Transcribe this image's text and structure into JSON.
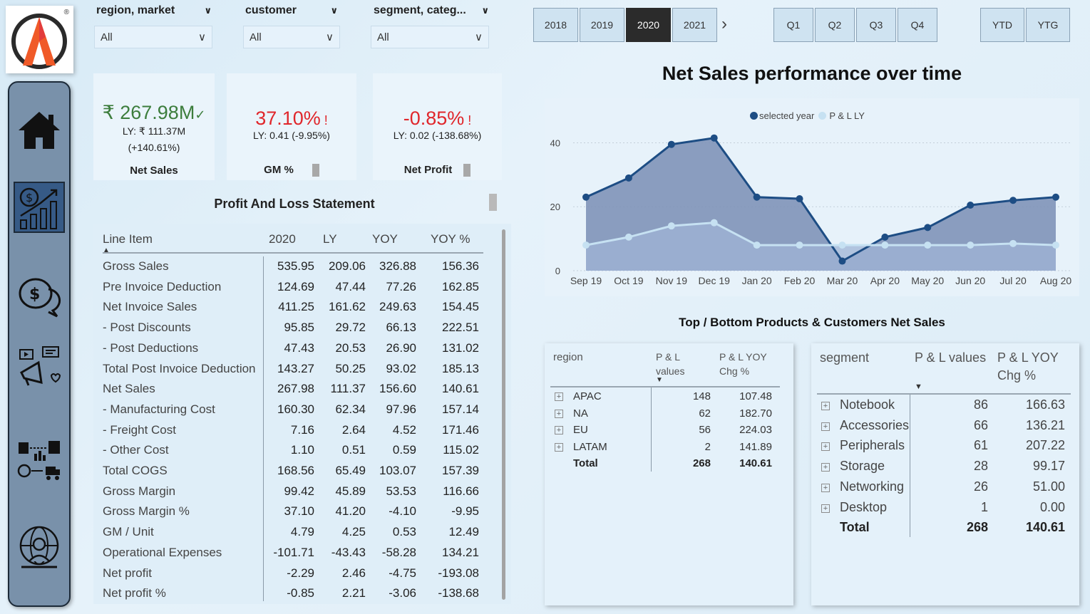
{
  "slicers": [
    {
      "title": "region, market",
      "value": "All"
    },
    {
      "title": "customer",
      "value": "All"
    },
    {
      "title": "segment, categ...",
      "value": "All"
    }
  ],
  "years": [
    "2018",
    "2019",
    "2020",
    "2021"
  ],
  "selected_year": "2020",
  "quarters": [
    "Q1",
    "Q2",
    "Q3",
    "Q4"
  ],
  "periods": [
    "YTD",
    "YTG"
  ],
  "kpis": {
    "net_sales": {
      "value": "₹ 267.98M",
      "ly": "LY: ₹ 111.37M",
      "chg": "(+140.61%)",
      "label": "Net Sales"
    },
    "gm": {
      "value": "37.10%",
      "ly": "LY: 0.41 (-9.95%)",
      "label": "GM %"
    },
    "np": {
      "value": "-0.85%",
      "ly": "LY: 0.02 (-138.68%)",
      "label": "Net Profit"
    }
  },
  "pl": {
    "title": "Profit And Loss Statement",
    "columns": [
      "Line Item",
      "2020",
      "LY",
      "YOY",
      "YOY %"
    ],
    "rows": [
      [
        "Gross Sales",
        "535.95",
        "209.06",
        "326.88",
        "156.36"
      ],
      [
        "Pre Invoice Deduction",
        "124.69",
        "47.44",
        "77.26",
        "162.85"
      ],
      [
        "Net Invoice Sales",
        "411.25",
        "161.62",
        "249.63",
        "154.45"
      ],
      [
        "- Post Discounts",
        "95.85",
        "29.72",
        "66.13",
        "222.51"
      ],
      [
        "- Post Deductions",
        "47.43",
        "20.53",
        "26.90",
        "131.02"
      ],
      [
        "Total Post Invoice Deduction",
        "143.27",
        "50.25",
        "93.02",
        "185.13"
      ],
      [
        "Net Sales",
        "267.98",
        "111.37",
        "156.60",
        "140.61"
      ],
      [
        "- Manufacturing Cost",
        "160.30",
        "62.34",
        "97.96",
        "157.14"
      ],
      [
        "- Freight Cost",
        "7.16",
        "2.64",
        "4.52",
        "171.46"
      ],
      [
        "- Other Cost",
        "1.10",
        "0.51",
        "0.59",
        "115.02"
      ],
      [
        "Total COGS",
        "168.56",
        "65.49",
        "103.07",
        "157.39"
      ],
      [
        "Gross Margin",
        "99.42",
        "45.89",
        "53.53",
        "116.66"
      ],
      [
        "Gross Margin %",
        "37.10",
        "41.20",
        "-4.10",
        "-9.95"
      ],
      [
        "GM / Unit",
        "4.79",
        "4.25",
        "0.53",
        "12.49"
      ],
      [
        "Operational Expenses",
        "-101.71",
        "-43.43",
        "-58.28",
        "134.21"
      ],
      [
        "Net profit",
        "-2.29",
        "2.46",
        "-4.75",
        "-193.08"
      ],
      [
        "Net profit %",
        "-0.85",
        "2.21",
        "-3.06",
        "-138.68"
      ]
    ]
  },
  "chart_title": "Net Sales performance over time",
  "chart_data": {
    "type": "area",
    "categories": [
      "Sep 19",
      "Oct 19",
      "Nov 19",
      "Dec 19",
      "Jan 20",
      "Feb 20",
      "Mar 20",
      "Apr 20",
      "May 20",
      "Jun 20",
      "Jul 20",
      "Aug 20"
    ],
    "series": [
      {
        "name": "selected year",
        "values": [
          23,
          29,
          39.5,
          41.5,
          23,
          22.5,
          3,
          10.5,
          13.5,
          20.5,
          22,
          23
        ]
      },
      {
        "name": "P & L LY",
        "values": [
          8,
          10.5,
          14,
          15,
          8,
          8,
          8,
          8,
          8,
          8,
          8.5,
          8
        ]
      }
    ],
    "yticks": [
      0,
      20,
      40
    ],
    "ylim": [
      0,
      45
    ],
    "legend": "top-center",
    "colors": {
      "selected": "#1d4d84",
      "selected_fill": "#7f93b8",
      "ly": "#c6e1f2",
      "ly_fill": "#9fb4d6"
    }
  },
  "top_bottom_title": "Top / Bottom Products & Customers Net Sales",
  "region_table": {
    "headers": [
      "region",
      "P & L",
      "values",
      "P & L YOY",
      "Chg %"
    ],
    "rows": [
      [
        "APAC",
        "148",
        "107.48"
      ],
      [
        "NA",
        "62",
        "182.70"
      ],
      [
        "EU",
        "56",
        "224.03"
      ],
      [
        "LATAM",
        "2",
        "141.89"
      ]
    ],
    "total": [
      "Total",
      "268",
      "140.61"
    ]
  },
  "segment_table": {
    "headers": [
      "segment",
      "P & L values",
      "P & L YOY",
      "Chg %"
    ],
    "rows": [
      [
        "Notebook",
        "86",
        "166.63"
      ],
      [
        "Accessories",
        "66",
        "136.21"
      ],
      [
        "Peripherals",
        "61",
        "207.22"
      ],
      [
        "Storage",
        "28",
        "99.17"
      ],
      [
        "Networking",
        "26",
        "51.00"
      ],
      [
        "Desktop",
        "1",
        "0.00"
      ]
    ],
    "total": [
      "Total",
      "268",
      "140.61"
    ]
  },
  "colors": {
    "positive": "#3c7d3c",
    "negative": "#e0262b",
    "selected_btn": "#2b2b2b",
    "nav": "#7991aa"
  }
}
